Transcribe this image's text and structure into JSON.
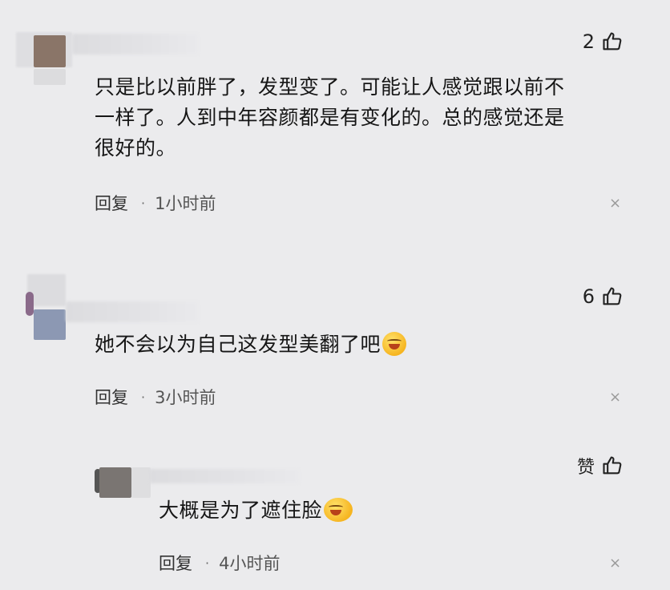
{
  "comments": [
    {
      "likes": "2",
      "text_lines": [
        "只是比以前胖了，发型变了。可能让人感觉跟以前不",
        "一样了。人到中年容颜都是有变化的。总的感觉还是",
        "很好的。"
      ],
      "reply_label": "回复",
      "dot": "·",
      "time": "1小时前",
      "close": "×"
    },
    {
      "likes": "6",
      "text": "她不会以为自己这发型美翻了吧",
      "reply_label": "回复",
      "dot": "·",
      "time": "3小时前",
      "close": "×"
    },
    {
      "likes": "赞",
      "text": "大概是为了遮住脸",
      "reply_label": "回复",
      "dot": "·",
      "time": "4小时前",
      "close": "×"
    }
  ],
  "colors": {
    "background": "#ebebed",
    "avatar1": "#8a7568",
    "avatar2": "#8c98b3",
    "avatar3": "#7a7572"
  },
  "icons": [
    "thumbs-up-icon",
    "close-icon",
    "laughing-emoji-icon"
  ]
}
